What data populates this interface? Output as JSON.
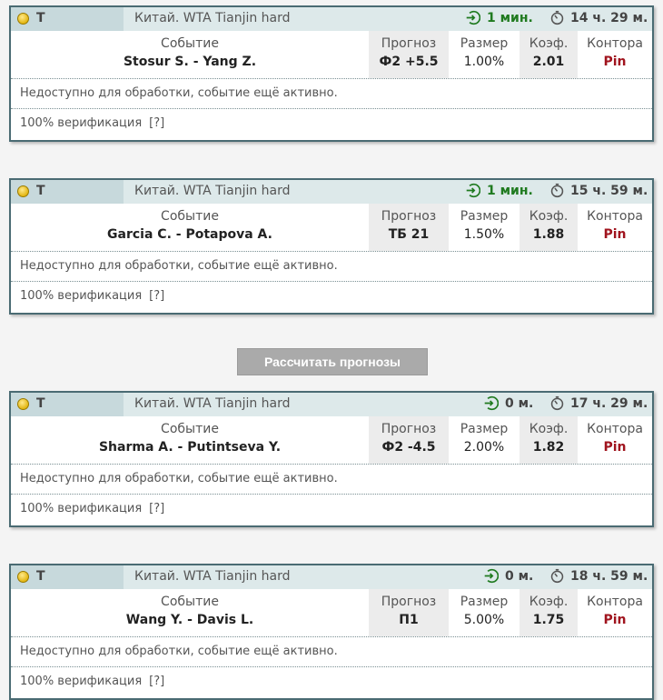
{
  "labels": {
    "event": "Событие",
    "forecast": "Прогноз",
    "size": "Размер",
    "coef": "Коэф.",
    "book": "Контора",
    "note": "Недоступно для обработки, событие ещё активно.",
    "verification": "100% верификация",
    "help": "[?]"
  },
  "calc_button": "Рассчитать прогнозы",
  "cards": [
    {
      "sport": "Т",
      "league": "Китай. WTA Tianjin hard",
      "timer": "1 мин.",
      "time_left": "14 ч. 29 м.",
      "event": "Stosur S. - Yang Z.",
      "forecast": "Ф2 +5.5",
      "size": "1.00%",
      "coef": "2.01",
      "book": "Pin"
    },
    {
      "sport": "Т",
      "league": "Китай. WTA Tianjin hard",
      "timer": "1 мин.",
      "time_left": "15 ч. 59 м.",
      "event": "Garcia C. - Potapova A.",
      "forecast": "ТБ 21",
      "size": "1.50%",
      "coef": "1.88",
      "book": "Pin"
    },
    {
      "sport": "Т",
      "league": "Китай. WTA Tianjin hard",
      "timer": "0 м.",
      "time_left": "17 ч. 29 м.",
      "event": "Sharma A. - Putintseva Y.",
      "forecast": "Ф2 -4.5",
      "size": "2.00%",
      "coef": "1.82",
      "book": "Pin"
    },
    {
      "sport": "Т",
      "league": "Китай. WTA Tianjin hard",
      "timer": "0 м.",
      "time_left": "18 ч. 59 м.",
      "event": "Wang Y. - Davis L.",
      "forecast": "П1",
      "size": "5.00%",
      "coef": "1.75",
      "book": "Pin"
    }
  ]
}
